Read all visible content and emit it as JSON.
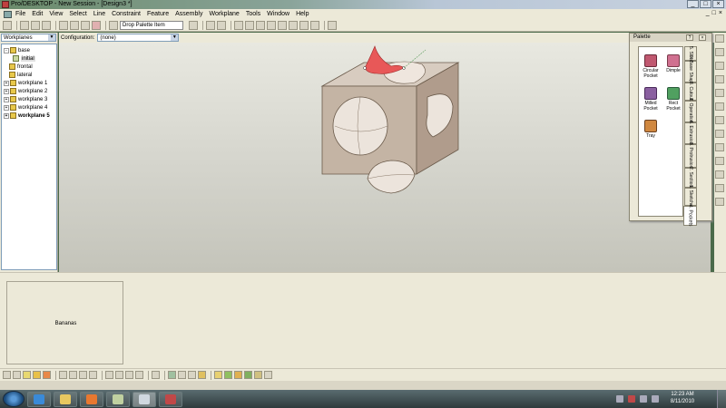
{
  "window": {
    "title": "Pro/DESKTOP - New Session - [Design3 *]",
    "controls": [
      "_",
      "□",
      "×"
    ]
  },
  "menu": {
    "items": [
      "File",
      "Edit",
      "View",
      "Select",
      "Line",
      "Constraint",
      "Feature",
      "Assembly",
      "Workplane",
      "Tools",
      "Window",
      "Help"
    ],
    "mdi_controls": [
      "_",
      "□",
      "×"
    ]
  },
  "toolbar": {
    "drop_input_value": "Drop Palette Item"
  },
  "tree": {
    "filter_select": "Workplanes",
    "items": [
      {
        "label": "base",
        "indent": 0,
        "expander": "-"
      },
      {
        "label": "initial",
        "indent": 1,
        "expander": ""
      },
      {
        "label": "frontal",
        "indent": 0,
        "expander": ""
      },
      {
        "label": "lateral",
        "indent": 0,
        "expander": ""
      },
      {
        "label": "workplane 1",
        "indent": 0,
        "expander": "+"
      },
      {
        "label": "workplane 2",
        "indent": 0,
        "expander": "+"
      },
      {
        "label": "workplane 3",
        "indent": 0,
        "expander": "+"
      },
      {
        "label": "workplane 4",
        "indent": 0,
        "expander": "+"
      },
      {
        "label": "workplane 5",
        "indent": 0,
        "expander": "+",
        "bold": true
      }
    ]
  },
  "config": {
    "label": "Configuration:",
    "value": "(none)"
  },
  "palette": {
    "title": "Palette",
    "items": [
      {
        "label": "Circular Pocket",
        "color": "#c05870"
      },
      {
        "label": "Dimple",
        "color": "#d07090"
      },
      {
        "label": "Milled Pocket",
        "color": "#8a60a0"
      },
      {
        "label": "Rect Pocket",
        "color": "#50a060"
      },
      {
        "label": "Tray",
        "color": "#d08840"
      }
    ],
    "tabs": [
      "5. Slots",
      "9. Base Shapes",
      "8. Cutouts",
      "7. Operations",
      "6. Extrusions",
      "3. Protrusions",
      "2. Sections",
      "1. Sketches",
      "4. Pockets"
    ]
  },
  "sketch_box": {
    "label": "Bananas"
  },
  "clock": {
    "time": "12:23 AM",
    "date": "8/11/2010"
  },
  "colors": {
    "model_face": "#c8b8a8",
    "highlight": "#e85858",
    "background_top": "#e8e8e0"
  }
}
